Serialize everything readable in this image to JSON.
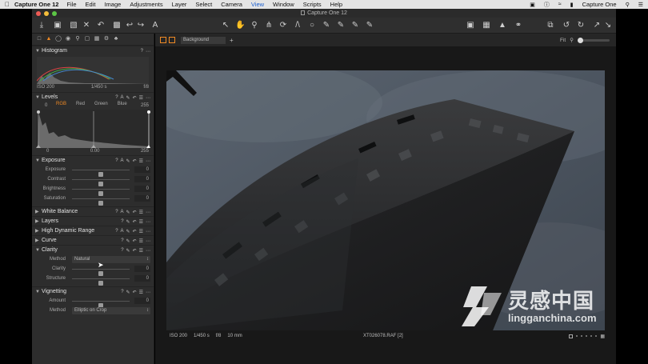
{
  "menubar": {
    "app_name": "Capture One 12",
    "items": [
      "File",
      "Edit",
      "Image",
      "Adjustments",
      "Layer",
      "Select",
      "Camera",
      "View",
      "Window",
      "Scripts",
      "Help"
    ],
    "active_item": "View",
    "right_app": "Capture One"
  },
  "window": {
    "title": "Capture One 12"
  },
  "histogram": {
    "title": "Histogram",
    "iso": "ISO 200",
    "shutter": "1/450 s",
    "aperture": "f/8"
  },
  "levels": {
    "title": "Levels",
    "low_value": "0",
    "high_value": "255",
    "channels": [
      "RGB",
      "Red",
      "Green",
      "Blue"
    ],
    "selected_channel": "RGB",
    "input_low": "0",
    "input_mid": "0.00",
    "input_high": "255"
  },
  "exposure": {
    "title": "Exposure",
    "sliders": [
      {
        "label": "Exposure",
        "value": "0",
        "level": 0.5
      },
      {
        "label": "Contrast",
        "value": "0",
        "level": 0.5
      },
      {
        "label": "Brightness",
        "value": "0",
        "level": 0.5
      },
      {
        "label": "Saturation",
        "value": "0",
        "level": 0.5
      }
    ]
  },
  "collapsed_tools": [
    "White Balance",
    "Layers",
    "High Dynamic Range",
    "Curve"
  ],
  "clarity": {
    "title": "Clarity",
    "method_label": "Method",
    "method_value": "Natural",
    "sliders": [
      {
        "label": "Clarity",
        "value": "0",
        "level": 0.5
      },
      {
        "label": "Structure",
        "value": "0",
        "level": 0.5
      }
    ]
  },
  "vignetting": {
    "title": "Vignetting",
    "amount_label": "Amount",
    "amount_value": "0",
    "amount_level": 0.5,
    "method_label": "Method",
    "method_value": "Elliptic on Crop"
  },
  "viewer": {
    "layer_select": "Background",
    "zoom_label": "Fit"
  },
  "info_bar": {
    "iso": "ISO 200",
    "shutter": "1/450 s",
    "aperture": "f/8",
    "focal": "10 mm",
    "filename": "XT026078.RAF [2]"
  },
  "watermark": {
    "text": "灵感中国",
    "url": "lingganchina.com"
  },
  "colors": {
    "accent": "#f08a24",
    "panel": "#2d2d2d",
    "viewer_bg": "#181818"
  }
}
